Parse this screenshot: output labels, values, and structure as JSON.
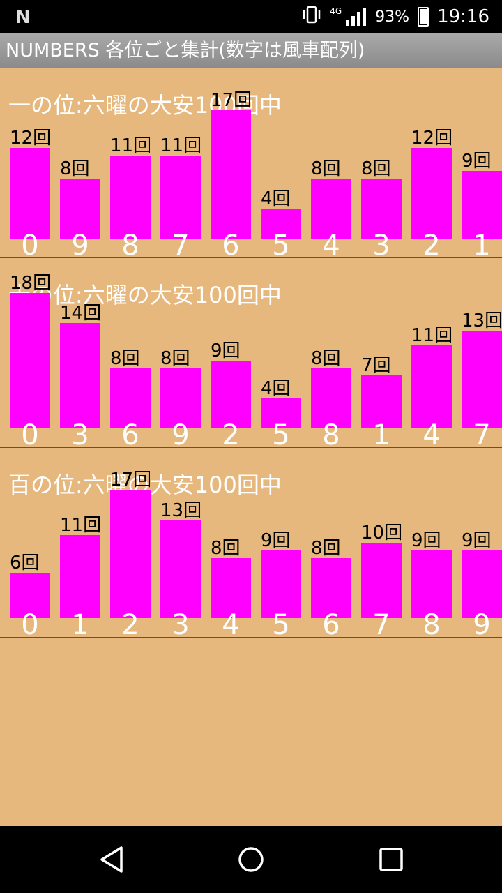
{
  "status_bar": {
    "notification_icon": "N",
    "vibrate_icon": "vibrate-icon",
    "network_type": "4G",
    "battery_percent": "93%",
    "time": "19:16"
  },
  "app_title": "NUMBERS 各位ごと集計(数字は風車配列)",
  "count_suffix": "回",
  "chart_data": [
    {
      "type": "bar",
      "title": "一の位:六曜の大安100回中",
      "categories": [
        "0",
        "9",
        "8",
        "7",
        "6",
        "5",
        "4",
        "3",
        "2",
        "1"
      ],
      "values": [
        12,
        8,
        11,
        11,
        17,
        4,
        8,
        8,
        12,
        9
      ],
      "ylim": [
        0,
        18
      ],
      "bar_color": "#ff00ff",
      "background": "#e6b87e"
    },
    {
      "type": "bar",
      "title": "十の位:六曜の大安100回中",
      "categories": [
        "0",
        "3",
        "6",
        "9",
        "2",
        "5",
        "8",
        "1",
        "4",
        "7"
      ],
      "values": [
        18,
        14,
        8,
        8,
        9,
        4,
        8,
        7,
        11,
        13
      ],
      "ylim": [
        0,
        18
      ],
      "bar_color": "#ff00ff",
      "background": "#e6b87e"
    },
    {
      "type": "bar",
      "title": "百の位:六曜の大安100回中",
      "categories": [
        "0",
        "1",
        "2",
        "3",
        "4",
        "5",
        "6",
        "7",
        "8",
        "9"
      ],
      "values": [
        6,
        11,
        17,
        13,
        8,
        9,
        8,
        10,
        9,
        9
      ],
      "ylim": [
        0,
        18
      ],
      "bar_color": "#ff00ff",
      "background": "#e6b87e"
    }
  ],
  "nav_bar": {
    "back_icon": "back-triangle-icon",
    "home_icon": "home-circle-icon",
    "recents_icon": "recents-square-icon"
  }
}
